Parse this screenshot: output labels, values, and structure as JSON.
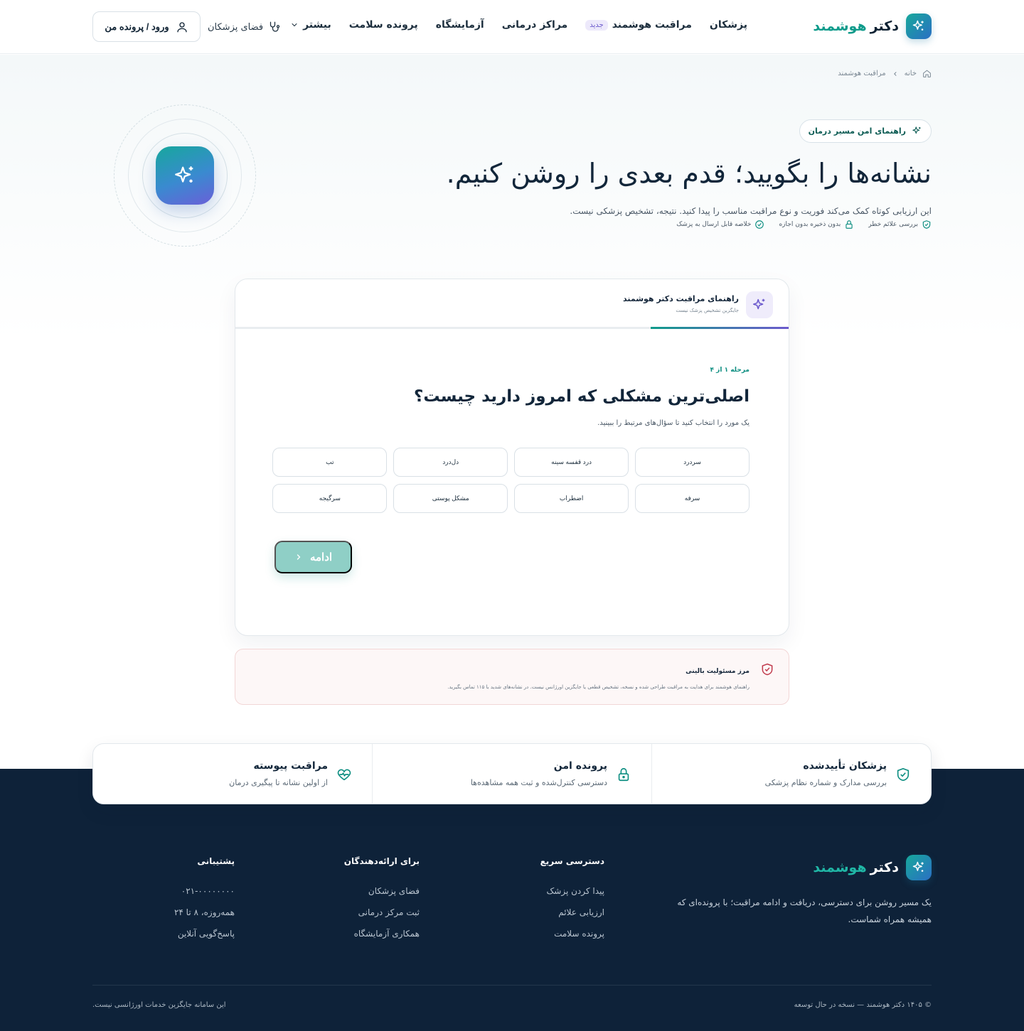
{
  "brand": {
    "name_part1": "دکتر",
    "name_part2": "هوشمند"
  },
  "nav": {
    "items": [
      "پزشکان",
      "مراقبت هوشمند",
      "مراکز درمانی",
      "آزمایشگاه",
      "پرونده سلامت",
      "بیشتر"
    ],
    "new_badge": "جدید",
    "doctor_space": "فضای پزشکان",
    "login": "ورود / پرونده من"
  },
  "breadcrumb": {
    "home": "خانه",
    "current": "مراقبت هوشمند"
  },
  "hero": {
    "pill": "راهنمای امن مسیر درمان",
    "title": "نشانه‌ها را بگویید؛ قدم بعدی را روشن کنیم.",
    "subtitle": "این ارزیابی کوتاه کمک می‌کند فوریت و نوع مراقبت مناسب را پیدا کنید. نتیجه، تشخیص پزشکی نیست.",
    "features": [
      "بررسی علائم خطر",
      "بدون ذخیره بدون اجازه",
      "خلاصه قابل ارسال به پزشک"
    ]
  },
  "wizard": {
    "title": "راهنمای مراقبت دکتر هوشمند",
    "subtitle": "جایگزین تشخیص پزشک نیست",
    "progress": 0.25,
    "step": "مرحله ۱ از ۴",
    "question": "اصلی‌ترین مشکلی که امروز دارید چیست؟",
    "hint": "یک مورد را انتخاب کنید تا سؤال‌های مرتبط را ببینید.",
    "options": [
      "سردرد",
      "درد قفسه سینه",
      "دل‌درد",
      "تب",
      "سرفه",
      "اضطراب",
      "مشکل پوستی",
      "سرگیجه"
    ],
    "continue": "ادامه"
  },
  "disclaimer": {
    "title": "مرز مسئولیت بالینی",
    "text": "راهنمای هوشمند برای هدایت به مراقبت طراحی شده و نسخه، تشخیص قطعی یا جایگزین اورژانس نیست. در نشانه‌های شدید با ۱۱۵ تماس بگیرید."
  },
  "trust": [
    {
      "title": "پزشکان تأییدشده",
      "desc": "بررسی مدارک و شماره نظام پزشکی",
      "icon": "shield-check-icon"
    },
    {
      "title": "پرونده امن",
      "desc": "دسترسی کنترل‌شده و ثبت همه مشاهده‌ها",
      "icon": "lock-icon"
    },
    {
      "title": "مراقبت پیوسته",
      "desc": "از اولین نشانه تا پیگیری درمان",
      "icon": "heart-pulse-icon"
    }
  ],
  "footer": {
    "description": "یک مسیر روشن برای دسترسی، دریافت و ادامه مراقبت؛ با پرونده‌ای که همیشه همراه شماست.",
    "columns": [
      {
        "title": "دسترسی سریع",
        "links": [
          "پیدا کردن پزشک",
          "ارزیابی علائم",
          "پرونده سلامت"
        ]
      },
      {
        "title": "برای ارائه‌دهندگان",
        "links": [
          "فضای پزشکان",
          "ثبت مرکز درمانی",
          "همکاری آزمایشگاه"
        ]
      },
      {
        "title": "پشتیبانی",
        "links": [
          "۰۲۱-۰۰۰۰۰۰۰۰",
          "همه‌روزه، ۸ تا ۲۴",
          "پاسخ‌گویی آنلاین"
        ]
      }
    ],
    "copyright": "© ۱۴۰۵ دکتر هوشمند — نسخه در حال توسعه",
    "note": "این سامانه جایگزین خدمات اورژانسی نیست."
  },
  "colors": {
    "primary": "#0f9b8b",
    "accent": "#6c5acd",
    "dark": "#0e2239"
  }
}
